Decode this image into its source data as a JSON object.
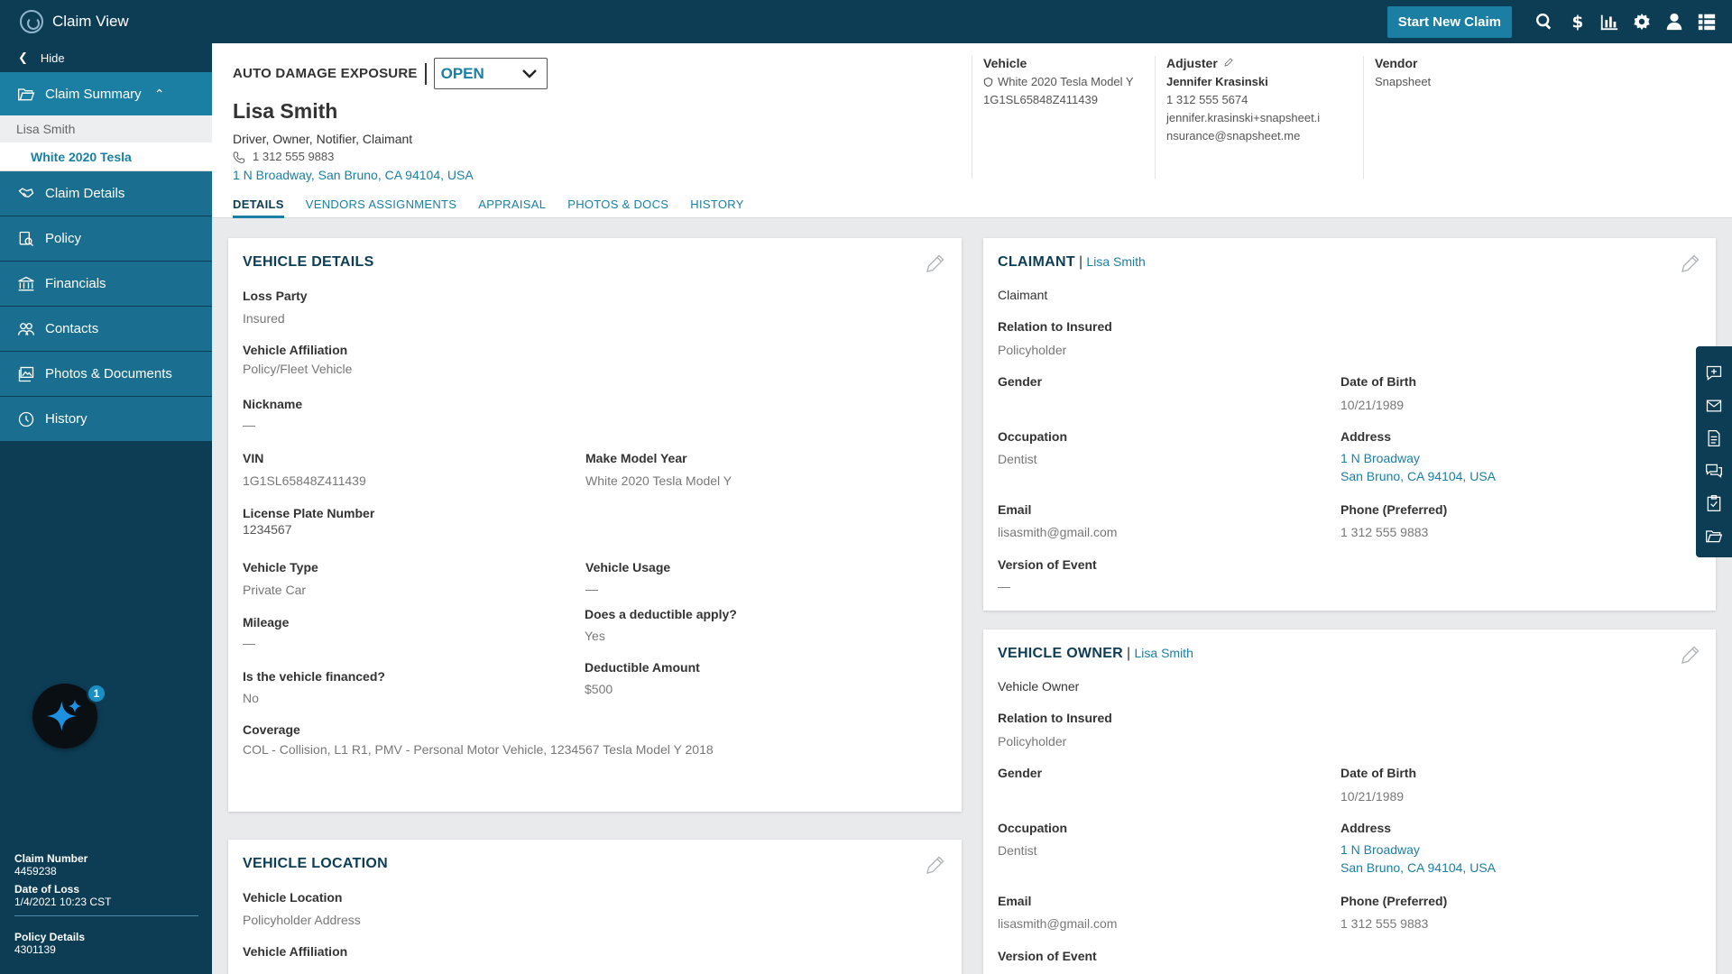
{
  "app": {
    "title": "Claim View",
    "new_claim_label": "Start New Claim",
    "top_icons": [
      "search-icon",
      "dollar-icon",
      "chart-icon",
      "gear-icon",
      "user-icon",
      "grid-icon"
    ]
  },
  "sidebar": {
    "hide_label": "Hide",
    "summary_label": "Claim Summary",
    "summary_party": "Lisa Smith",
    "summary_vehicle": "White 2020 Tesla",
    "items": [
      {
        "label": "Claim Details",
        "icon": "claim-details-icon"
      },
      {
        "label": "Policy",
        "icon": "policy-icon"
      },
      {
        "label": "Financials",
        "icon": "bank-icon"
      },
      {
        "label": "Contacts",
        "icon": "contacts-icon"
      },
      {
        "label": "Photos & Documents",
        "icon": "photos-icon"
      },
      {
        "label": "History",
        "icon": "history-icon"
      }
    ],
    "ai_badge_count": "1",
    "claim_number_label": "Claim Number",
    "claim_number": "4459238",
    "date_of_loss_label": "Date of Loss",
    "date_of_loss": "1/4/2021 10:23 CST",
    "policy_details_label": "Policy Details",
    "policy_details": "4301139"
  },
  "header": {
    "exposure_label": "AUTO DAMAGE EXPOSURE",
    "status_value": "OPEN",
    "party_name": "Lisa Smith",
    "party_roles": "Driver, Owner, Notifier, Claimant",
    "party_phone": "1 312 555 9883",
    "party_address": "1 N Broadway, San Bruno, CA 94104, USA",
    "tabs": [
      "DETAILS",
      "VENDORS ASSIGNMENTS",
      "APPRAISAL",
      "PHOTOS & DOCS",
      "HISTORY"
    ],
    "vehicle": {
      "title": "Vehicle",
      "name": "White 2020 Tesla Model Y",
      "vin": "1G1SL65848Z411439"
    },
    "adjuster": {
      "title": "Adjuster",
      "name": "Jennifer Krasinski",
      "phone": "1 312 555 5674",
      "email_line1": "jennifer.krasinski+snapsheet.i",
      "email_line2": "nsurance@snapsheet.me"
    },
    "vendor": {
      "title": "Vendor",
      "name": "Snapsheet"
    }
  },
  "vehicle_details": {
    "title": "VEHICLE DETAILS",
    "loss_party_label": "Loss Party",
    "loss_party": "Insured",
    "affiliation_label": "Vehicle Affiliation",
    "affiliation": "Policy/Fleet Vehicle",
    "nickname_label": "Nickname",
    "nickname": "—",
    "vin_label": "VIN",
    "vin": "1G1SL65848Z411439",
    "mmy_label": "Make Model Year",
    "mmy": "White 2020 Tesla Model Y",
    "plate_label": "License Plate Number",
    "plate": "1234567",
    "type_label": "Vehicle Type",
    "type": "Private Car",
    "usage_label": "Vehicle Usage",
    "usage": "—",
    "mileage_label": "Mileage",
    "mileage": "—",
    "deductible_apply_label": "Does a deductible apply?",
    "deductible_apply": "Yes",
    "financed_label": "Is the vehicle financed?",
    "financed": "No",
    "deductible_amount_label": "Deductible Amount",
    "deductible_amount": "$500",
    "coverage_label": "Coverage",
    "coverage": "COL - Collision, L1 R1, PMV - Personal Motor Vehicle, 1234567 Tesla Model Y 2018"
  },
  "vehicle_location": {
    "title": "VEHICLE LOCATION",
    "location_label": "Vehicle Location",
    "location": "Policyholder Address",
    "affiliation_label": "Vehicle Affiliation"
  },
  "claimant": {
    "title": "CLAIMANT",
    "name": "Lisa Smith",
    "role": "Claimant",
    "relation_label": "Relation to Insured",
    "relation": "Policyholder",
    "gender_label": "Gender",
    "dob_label": "Date of Birth",
    "dob": "10/21/1989",
    "occupation_label": "Occupation",
    "occupation": "Dentist",
    "address_label": "Address",
    "address_line1": "1 N Broadway",
    "address_line2": "San Bruno, CA 94104, USA",
    "email_label": "Email",
    "email": "lisasmith@gmail.com",
    "phone_label": "Phone (Preferred)",
    "phone": "1 312 555 9883",
    "version_label": "Version of Event",
    "version": "—"
  },
  "vehicle_owner": {
    "title": "VEHICLE OWNER",
    "name": "Lisa Smith",
    "role": "Vehicle Owner",
    "relation_label": "Relation to Insured",
    "relation": "Policyholder",
    "gender_label": "Gender",
    "dob_label": "Date of Birth",
    "dob": "10/21/1989",
    "occupation_label": "Occupation",
    "occupation": "Dentist",
    "address_label": "Address",
    "address_line1": "1 N Broadway",
    "address_line2": "San Bruno, CA 94104, USA",
    "email_label": "Email",
    "email": "lisasmith@gmail.com",
    "phone_label": "Phone (Preferred)",
    "phone": "1 312 555 9883",
    "version_label": "Version of Event"
  },
  "float_bar_icons": [
    "add-note-icon",
    "mail-icon",
    "document-icon",
    "chat-icon",
    "clipboard-icon",
    "folder-icon"
  ]
}
